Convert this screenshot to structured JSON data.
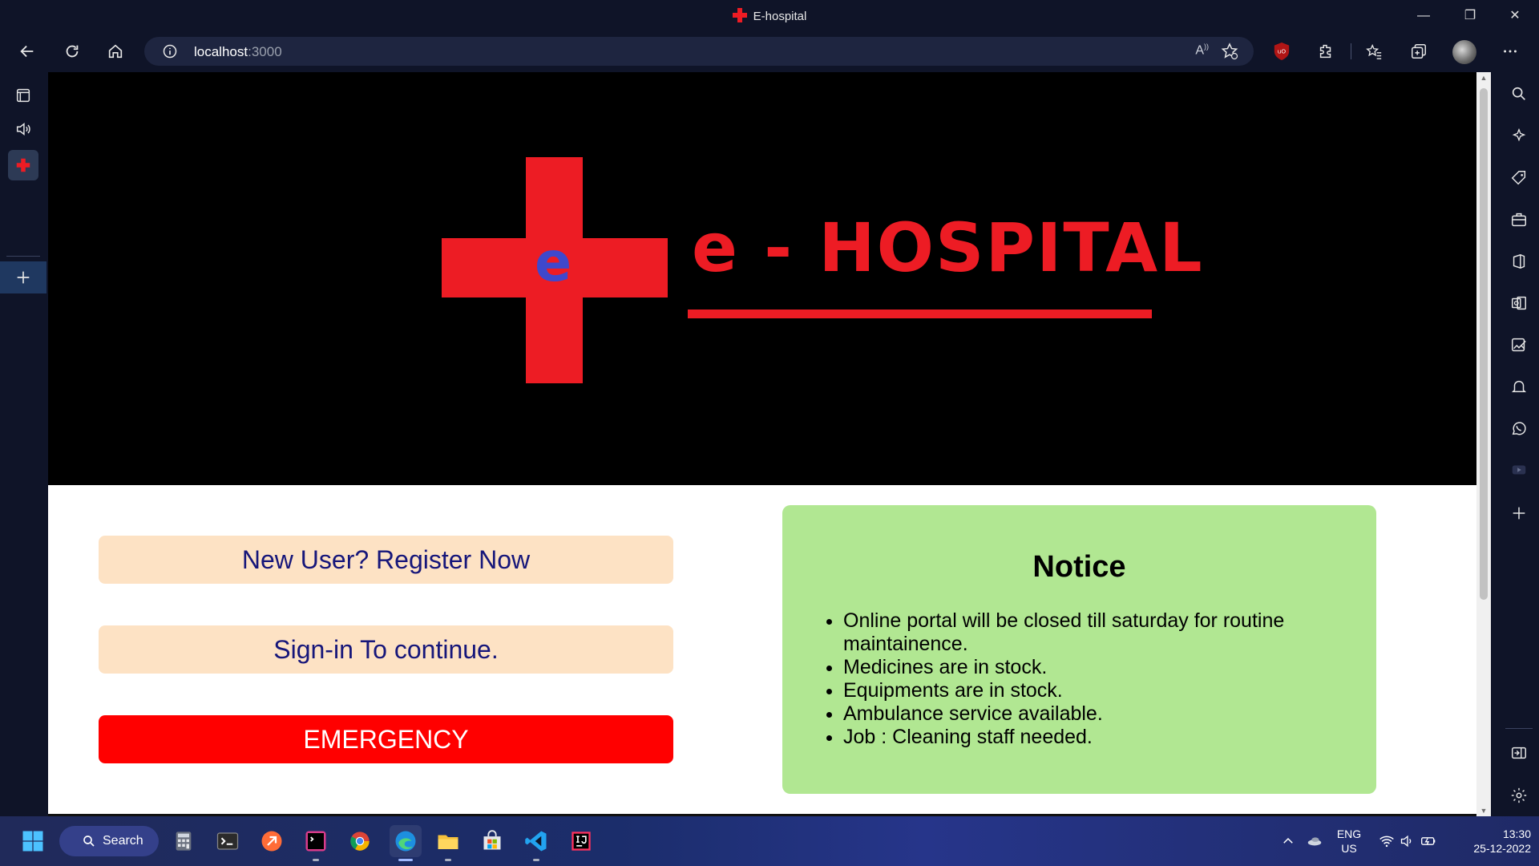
{
  "window": {
    "title": "E-hospital"
  },
  "address_bar": {
    "host": "localhost",
    "port": ":3000"
  },
  "banner": {
    "logo_letter": "e",
    "brand_text": "e - HOSPITAL"
  },
  "buttons": {
    "register": "New User? Register Now",
    "signin": "Sign-in To continue.",
    "emergency": "EMERGENCY"
  },
  "notice": {
    "title": "Notice",
    "items": [
      "Online portal will be closed till saturday for routine maintainence.",
      "Medicines are in stock.",
      "Equipments are in stock.",
      "Ambulance service available.",
      "Job : Cleaning staff needed."
    ]
  },
  "taskbar": {
    "search_label": "Search",
    "lang_line1": "ENG",
    "lang_line2": "US",
    "time": "13:30",
    "date": "25-12-2022"
  },
  "colors": {
    "brand_red": "#ed1c24",
    "logo_blue": "#3f48cc",
    "button_peach": "#fde2c4",
    "button_text_navy": "#16167a",
    "emergency_red": "#ff0000",
    "notice_green": "#b1e792"
  },
  "icons": {
    "toolbar": [
      "back-icon",
      "refresh-icon",
      "home-icon",
      "info-icon",
      "read-aloud-icon",
      "add-favorite-icon",
      "ublock-icon",
      "extensions-icon",
      "favorites-icon",
      "collections-icon",
      "profile-avatar",
      "more-icon"
    ],
    "left_sidebar": [
      "tab-actions-icon",
      "audio-icon",
      "hospital-tab-icon",
      "new-tab-icon"
    ],
    "right_sidebar": [
      "search-icon",
      "copilot-icon",
      "shopping-icon",
      "tools-icon",
      "office-icon",
      "outlook-icon",
      "image-creator-icon",
      "notification-icon",
      "whatsapp-icon",
      "youtube-icon",
      "add-icon",
      "hide-sidebar-icon",
      "settings-icon"
    ]
  }
}
